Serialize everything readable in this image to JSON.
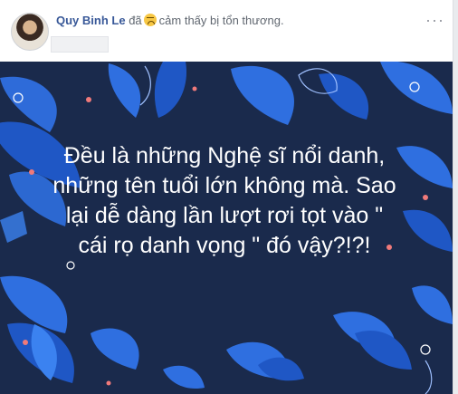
{
  "post": {
    "author": "Quy Binh Le",
    "status_prefix": "đã",
    "feeling_icon": "sad-face-icon",
    "status_text": "cảm thấy bị tổn thương.",
    "menu_icon": "more-horizontal-icon",
    "menu_glyph": "···",
    "image_text": "Đều là những Nghệ sĩ nổi danh, những tên tuổi lớn không mà. Sao lại dễ dàng lần lượt rơi tọt vào \" cái rọ danh vọng \" đó vậy?!?!",
    "colors": {
      "background": "#1a2a4c",
      "leaf_blue": "#2f6fe0",
      "accent_pink": "#f07a7a",
      "text": "#ffffff"
    }
  }
}
